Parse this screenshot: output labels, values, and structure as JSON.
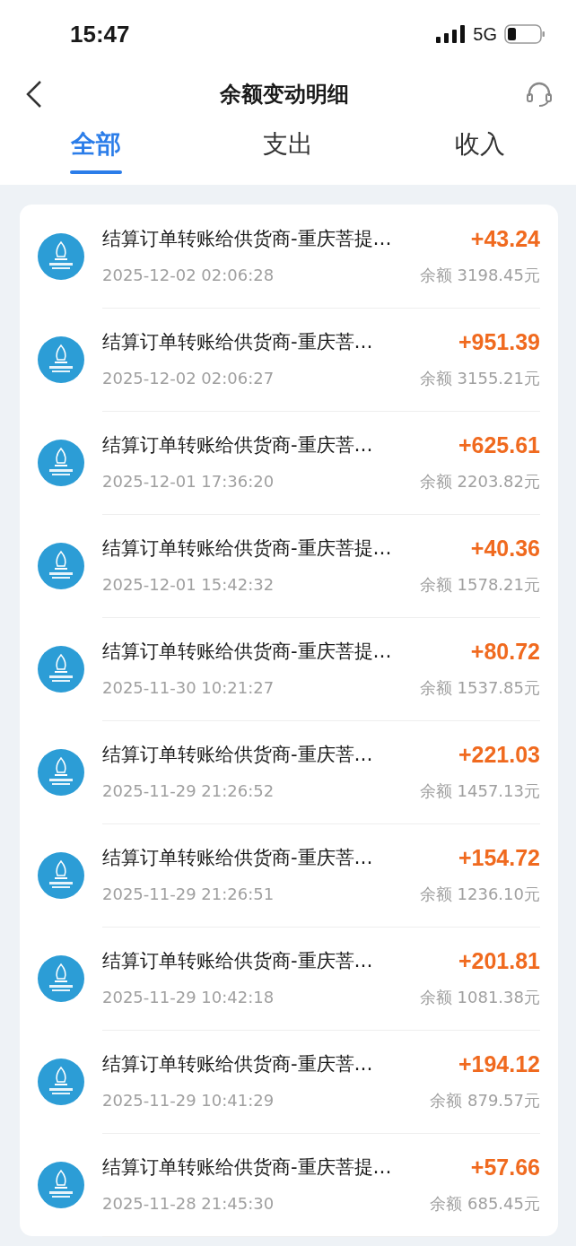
{
  "status_bar": {
    "time": "15:47",
    "network": "5G"
  },
  "header": {
    "title": "余额变动明细"
  },
  "tabs": [
    {
      "label": "全部",
      "selected": true
    },
    {
      "label": "支出",
      "selected": false
    },
    {
      "label": "收入",
      "selected": false
    }
  ],
  "transactions": [
    {
      "title": "结算订单转账给供货商-重庆菩提…",
      "amount": "+43.24",
      "time": "2025-12-02 02:06:28",
      "balance": "余额 3198.45元"
    },
    {
      "title": "结算订单转账给供货商-重庆菩…",
      "amount": "+951.39",
      "time": "2025-12-02 02:06:27",
      "balance": "余额 3155.21元"
    },
    {
      "title": "结算订单转账给供货商-重庆菩…",
      "amount": "+625.61",
      "time": "2025-12-01 17:36:20",
      "balance": "余额 2203.82元"
    },
    {
      "title": "结算订单转账给供货商-重庆菩提…",
      "amount": "+40.36",
      "time": "2025-12-01 15:42:32",
      "balance": "余额 1578.21元"
    },
    {
      "title": "结算订单转账给供货商-重庆菩提…",
      "amount": "+80.72",
      "time": "2025-11-30 10:21:27",
      "balance": "余额 1537.85元"
    },
    {
      "title": "结算订单转账给供货商-重庆菩…",
      "amount": "+221.03",
      "time": "2025-11-29 21:26:52",
      "balance": "余额 1457.13元"
    },
    {
      "title": "结算订单转账给供货商-重庆菩…",
      "amount": "+154.72",
      "time": "2025-11-29 21:26:51",
      "balance": "余额 1236.10元"
    },
    {
      "title": "结算订单转账给供货商-重庆菩…",
      "amount": "+201.81",
      "time": "2025-11-29 10:42:18",
      "balance": "余额 1081.38元"
    },
    {
      "title": "结算订单转账给供货商-重庆菩…",
      "amount": "+194.12",
      "time": "2025-11-29 10:41:29",
      "balance": "余额 879.57元"
    },
    {
      "title": "结算订单转账给供货商-重庆菩提…",
      "amount": "+57.66",
      "time": "2025-11-28 21:45:30",
      "balance": "余额 685.45元"
    }
  ]
}
